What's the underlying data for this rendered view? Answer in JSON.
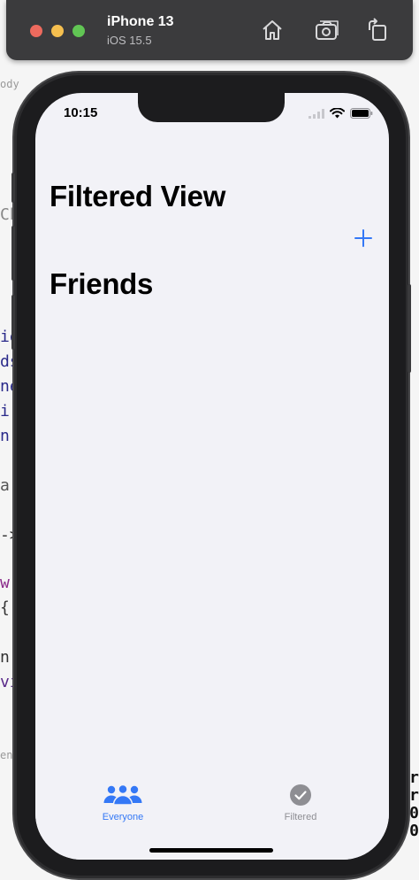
{
  "simulator": {
    "device_name": "iPhone 13",
    "os_version": "iOS 15.5",
    "icons": [
      "home-icon",
      "screenshot-icon",
      "rotate-icon"
    ]
  },
  "backdrop": {
    "left_code": [
      "ody",
      "Ch",
      "ie",
      "ds",
      "ne",
      " i",
      " n",
      "ar",
      "->",
      "w",
      " {",
      "n(",
      "vi",
      "en"
    ],
    "right_code": [
      "r",
      "r",
      "0",
      "0"
    ]
  },
  "status_bar": {
    "time": "10:15"
  },
  "nav": {
    "title": "Filtered View",
    "add_icon": "plus-icon"
  },
  "list": {
    "section_title": "Friends"
  },
  "tabbar": {
    "tabs": [
      {
        "label": "Everyone",
        "icon": "person-3-fill-icon",
        "selected": true
      },
      {
        "label": "Filtered",
        "icon": "checkmark-circle-fill-icon",
        "selected": false
      }
    ]
  },
  "colors": {
    "accent": "#3478f6",
    "inactive": "#8e8e93",
    "background": "#f2f2f7"
  }
}
